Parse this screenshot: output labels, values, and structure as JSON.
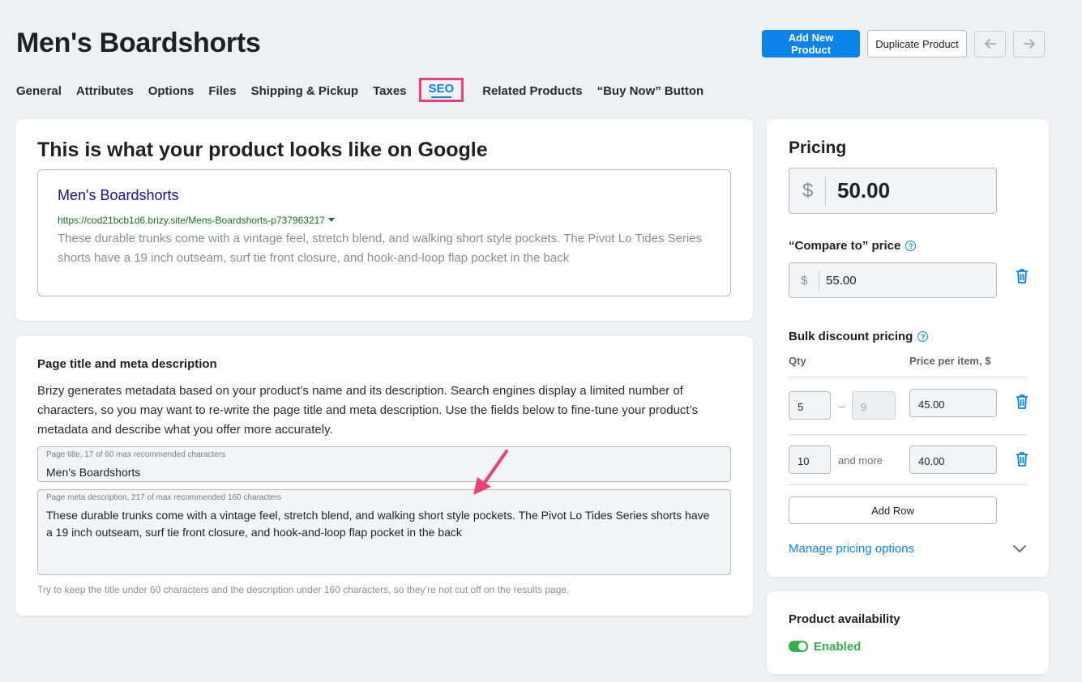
{
  "header": {
    "title": "Men's Boardshorts",
    "add_new_product": "Add New Product",
    "duplicate_product": "Duplicate Product"
  },
  "tabs": [
    {
      "label": "General"
    },
    {
      "label": "Attributes"
    },
    {
      "label": "Options"
    },
    {
      "label": "Files"
    },
    {
      "label": "Shipping & Pickup"
    },
    {
      "label": "Taxes"
    },
    {
      "label": "SEO",
      "active": true
    },
    {
      "label": "Related Products"
    },
    {
      "label": "“Buy Now” Button"
    }
  ],
  "google_preview": {
    "heading": "This is what your product looks like on Google",
    "result_title": "Men's Boardshorts",
    "result_url": "https://cod21bcb1d6.brizy.site/Mens-Boardshorts-p737963217",
    "result_description": "These durable trunks come with a vintage feel, stretch blend, and walking short style pockets. The Pivot Lo Tides Series shorts have a 19 inch outseam, surf tie front closure, and hook-and-loop flap pocket in the back"
  },
  "meta": {
    "heading": "Page title and meta description",
    "intro": "Brizy generates metadata based on your product’s name and its description. Search engines display a limited number of characters, so you may want to re-write the page title and meta description. Use the fields below to fine-tune your product’s metadata and describe what you offer more accurately.",
    "title_field_label": "Page title, 17 of 60 max recommended characters",
    "title_field_value": "Men's Boardshorts",
    "desc_field_label": "Page meta description, 217 of max recommended 160 characters",
    "desc_field_value": "These durable trunks come with a vintage feel, stretch blend, and walking short style pockets. The Pivot Lo Tides Series shorts have a 19 inch outseam, surf tie front closure, and hook-and-loop flap pocket in the back",
    "hint": "Try to keep the title under 60 characters and the description under 160 characters, so they’re not cut off on the results page."
  },
  "pricing": {
    "heading": "Pricing",
    "currency": "$",
    "price": "50.00",
    "compare_label": "“Compare to” price",
    "compare_price": "55.00",
    "bulk_label": "Bulk discount pricing",
    "col_qty": "Qty",
    "col_price": "Price per item, $",
    "rows": [
      {
        "qty_from": "5",
        "dash": "–",
        "qty_to": "9",
        "price": "45.00"
      },
      {
        "qty_from": "10",
        "and_more": "and more",
        "price": "40.00"
      }
    ],
    "add_row": "Add Row",
    "manage_link": "Manage pricing options"
  },
  "availability": {
    "heading": "Product availability",
    "status": "Enabled",
    "enabled": true
  },
  "colors": {
    "accent": "#0a84e8",
    "highlight": "#ee3f76",
    "enabled_green": "#2fb24a"
  }
}
